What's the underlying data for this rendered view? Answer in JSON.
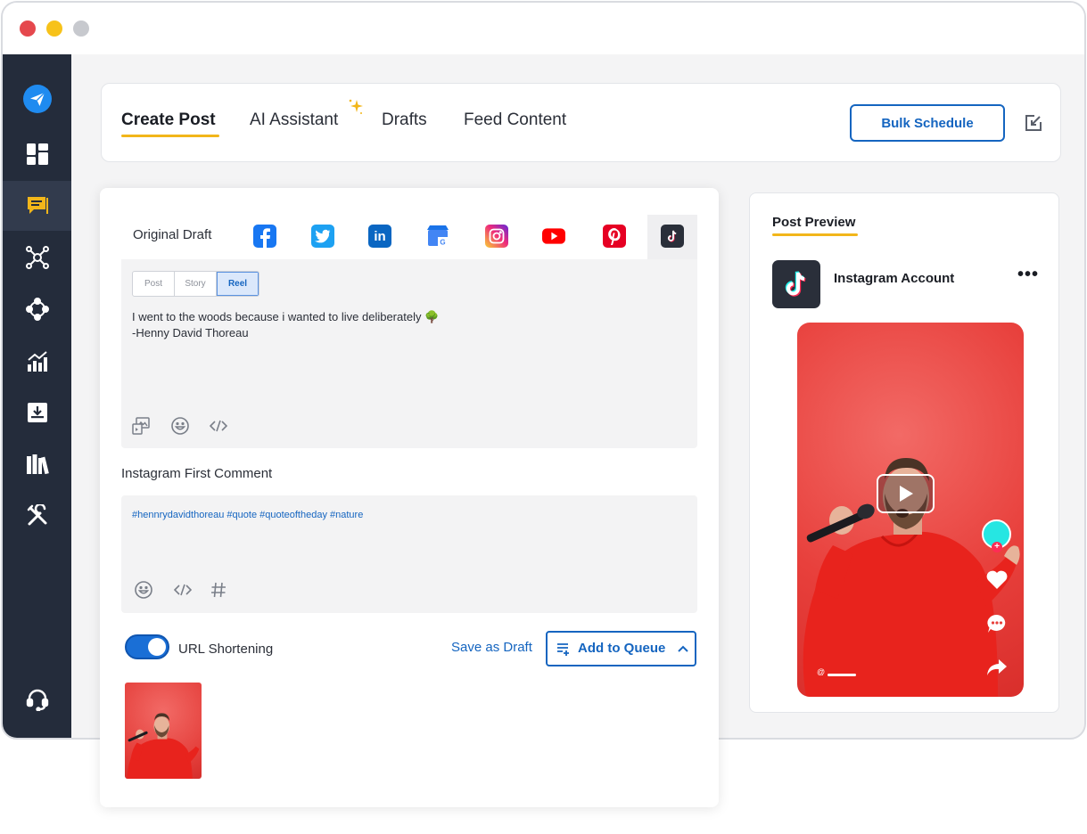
{
  "window": {
    "controls": [
      "close",
      "minimize",
      "zoom"
    ]
  },
  "sidebar": {
    "items": [
      {
        "icon": "paper-plane-icon",
        "active": false
      },
      {
        "icon": "dashboard-grid-icon",
        "active": false
      },
      {
        "icon": "compose-post-icon",
        "active": true
      },
      {
        "icon": "network-nodes-icon",
        "active": false
      },
      {
        "icon": "workflow-icon",
        "active": false
      },
      {
        "icon": "analytics-chart-icon",
        "active": false
      },
      {
        "icon": "inbox-download-icon",
        "active": false
      },
      {
        "icon": "library-books-icon",
        "active": false
      },
      {
        "icon": "tools-icon",
        "active": false
      },
      {
        "icon": "support-headset-icon",
        "active": false
      }
    ],
    "accent_color": "#f2b61a"
  },
  "header": {
    "tabs": [
      {
        "label": "Create Post",
        "active": true
      },
      {
        "label": "AI Assistant",
        "active": false
      },
      {
        "label": "Drafts",
        "active": false
      },
      {
        "label": "Feed Content",
        "active": false
      }
    ],
    "bulk_schedule_label": "Bulk Schedule",
    "accent_color": "#1565c0"
  },
  "composer": {
    "original_draft_label": "Original Draft",
    "networks": [
      {
        "name": "facebook",
        "icon": "facebook-icon",
        "color": "#1877f2"
      },
      {
        "name": "twitter",
        "icon": "twitter-icon",
        "color": "#1da1f2"
      },
      {
        "name": "linkedin",
        "icon": "linkedin-icon",
        "color": "#0a66c2"
      },
      {
        "name": "google-business",
        "icon": "google-business-icon",
        "color": "#4285f4"
      },
      {
        "name": "instagram",
        "icon": "instagram-icon",
        "color": "#e1306c"
      },
      {
        "name": "youtube",
        "icon": "youtube-icon",
        "color": "#ff0000"
      },
      {
        "name": "pinterest",
        "icon": "pinterest-icon",
        "color": "#e60023"
      },
      {
        "name": "tiktok",
        "icon": "tiktok-icon",
        "color": "#2a2f3a",
        "selected": true
      }
    ],
    "post_types": [
      {
        "label": "Post",
        "active": false
      },
      {
        "label": "Story",
        "active": false
      },
      {
        "label": "Reel",
        "active": true
      }
    ],
    "draft_line_1": "I went to the woods because i wanted to live deliberately 🌳",
    "draft_line_2": "-Henny David Thoreau",
    "first_comment_label": "Instagram First Comment",
    "first_comment_text": "#hennrydavidthoreau #quote #quoteoftheday #nature",
    "url_shortening_label": "URL Shortening",
    "url_shortening_on": true,
    "save_draft_label": "Save as Draft",
    "add_to_queue_label": "Add to Queue"
  },
  "preview": {
    "title": "Post Preview",
    "account_name": "Instagram Account",
    "more_label": "•••",
    "handle_prefix": "@"
  }
}
